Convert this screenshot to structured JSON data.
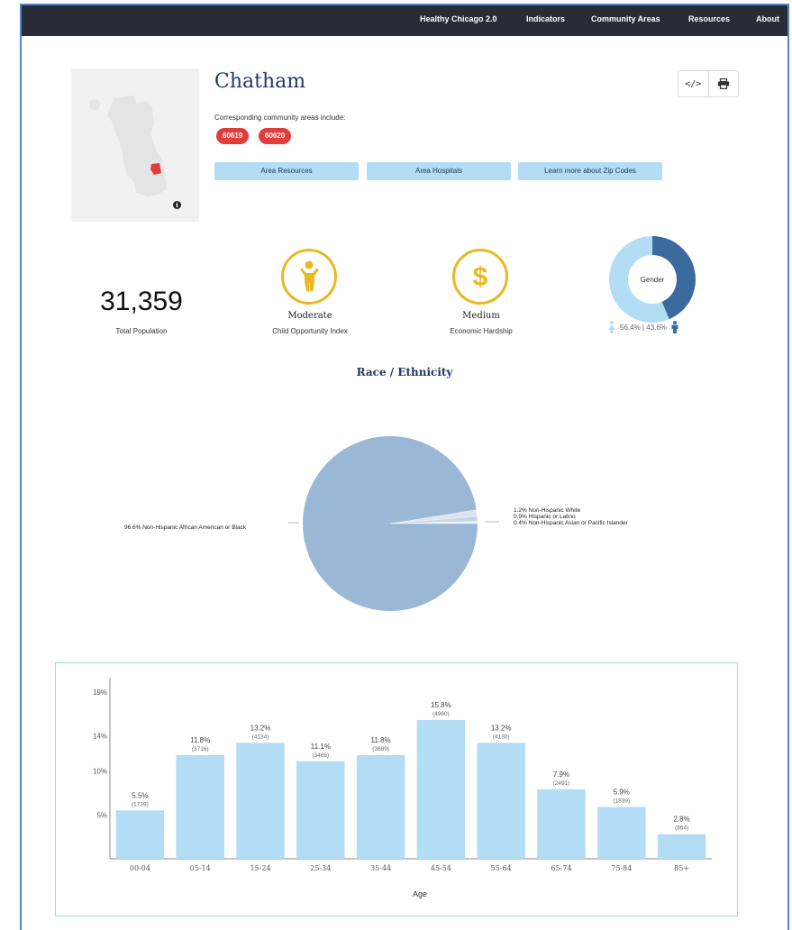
{
  "nav": {
    "items": [
      "Healthy Chicago 2.0",
      "Indicators",
      "Community Areas",
      "Resources",
      "About"
    ]
  },
  "area": {
    "name": "Chatham",
    "corresponding_label": "Corresponding community areas include:",
    "zip_codes": [
      "60619",
      "60620"
    ],
    "buttons": [
      "Area Resources",
      "Area Hospitals",
      "Learn more about Zip Codes"
    ],
    "map_info_icon": "info-icon"
  },
  "tools": {
    "embed_icon": "</>",
    "print_icon": "printer-icon"
  },
  "stats": {
    "population_value": "31,359",
    "population_label": "Total Population",
    "child_opportunity_value": "Moderate",
    "child_opportunity_label": "Child Opportunity Index",
    "economic_hardship_value": "Medium",
    "economic_hardship_label": "Economic Hardship",
    "gender_title": "Gender",
    "gender_text": "56.4% | 43.6%",
    "gender_female_pct": 56.4,
    "gender_male_pct": 43.6
  },
  "colors": {
    "accent_yellow": "#e8b923",
    "female_blue": "#b3dcf5",
    "male_blue": "#3b6b9e",
    "bar_blue": "#b3dcf5",
    "pie_blue": "#9ab8d6",
    "chip_red": "#e23c3c",
    "title_navy": "#1f3864"
  },
  "race": {
    "title": "Race / Ethnicity",
    "labels": {
      "black": "96.6% Non-Hispanic African American or Black",
      "white": "1.2% Non-Hispanic White",
      "latino": "0.9% Hispanic or Latino",
      "asian": "0.4% Non-Hispanic Asian or Pacific Islander"
    }
  },
  "chart_data": [
    {
      "type": "pie",
      "title": "Race / Ethnicity",
      "categories": [
        "Non-Hispanic African American or Black",
        "Non-Hispanic White",
        "Hispanic or Latino",
        "Non-Hispanic Asian or Pacific Islander"
      ],
      "values": [
        96.6,
        1.2,
        0.9,
        0.4
      ]
    },
    {
      "type": "bar",
      "categories": [
        "00-04",
        "05-14",
        "15-24",
        "25-34",
        "35-44",
        "45-54",
        "55-64",
        "65-74",
        "75-84",
        "85+"
      ],
      "values": [
        5.5,
        11.8,
        13.2,
        11.1,
        11.8,
        15.8,
        13.2,
        7.9,
        5.9,
        2.8
      ],
      "value_labels": [
        "5.5%",
        "11.8%",
        "13.2%",
        "11.1%",
        "11.8%",
        "15.8%",
        "13.2%",
        "7.9%",
        "5.9%",
        "2.8%"
      ],
      "counts": [
        "(1739)",
        "(3716)",
        "(4134)",
        "(3466)",
        "(3689)",
        "(4960)",
        "(4130)",
        "(2491)",
        "(1839)",
        "(864)"
      ],
      "xlabel": "Age",
      "ylabel": "",
      "yticks": [
        "5%",
        "10%",
        "14%",
        "19%"
      ],
      "ytick_values": [
        5,
        10,
        14,
        19
      ],
      "ylim": [
        0,
        20
      ],
      "grid": false
    }
  ]
}
